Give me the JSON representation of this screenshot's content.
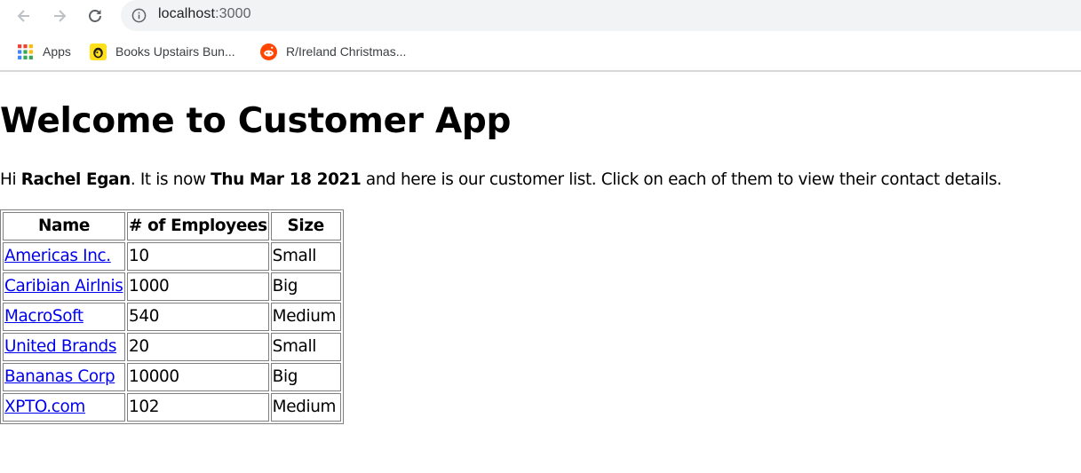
{
  "browser": {
    "url_host": "localhost",
    "url_port": ":3000",
    "bookmarks": [
      {
        "label": "Apps",
        "icon": "apps-grid-icon"
      },
      {
        "label": "Books Upstairs Bun...",
        "icon": "mailchimp-icon"
      },
      {
        "label": "R/Ireland Christmas...",
        "icon": "reddit-icon"
      }
    ]
  },
  "page": {
    "title": "Welcome to Customer App",
    "intro": {
      "greeting": "Hi ",
      "user_name": "Rachel Egan",
      "middle": ". It is now ",
      "date": "Thu Mar 18 2021",
      "tail": " and here is our customer list. Click on each of them to view their contact details."
    },
    "table": {
      "headers": [
        "Name",
        "# of Employees",
        "Size"
      ],
      "rows": [
        {
          "name": "Americas Inc.",
          "employees": "10",
          "size": "Small"
        },
        {
          "name": "Caribian Airlnis",
          "employees": "1000",
          "size": "Big"
        },
        {
          "name": "MacroSoft",
          "employees": "540",
          "size": "Medium"
        },
        {
          "name": "United Brands",
          "employees": "20",
          "size": "Small"
        },
        {
          "name": "Bananas Corp",
          "employees": "10000",
          "size": "Big"
        },
        {
          "name": "XPTO.com",
          "employees": "102",
          "size": "Medium"
        }
      ]
    }
  },
  "colors": {
    "link": "#0000ee",
    "omnibox_bg": "#f1f3f4",
    "reddit": "#ff4500",
    "mailchimp": "#ffe01b"
  }
}
